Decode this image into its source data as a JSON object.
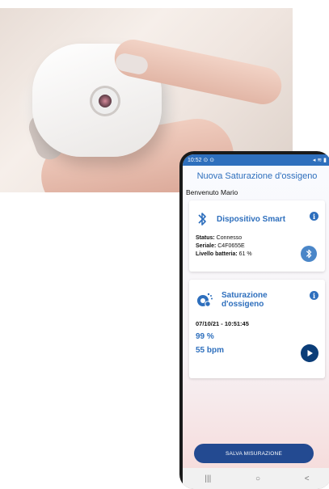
{
  "status_bar": {
    "time": "10:52",
    "left_icons": "⊙ ⊙",
    "right_icons": "◂ ≋ ▮"
  },
  "app": {
    "title": "Nuova Saturazione d'ossigeno",
    "welcome": "Benvenuto Mario"
  },
  "device_card": {
    "title": "Dispositivo Smart",
    "status_label": "Status:",
    "status_value": " Connesso",
    "serial_label": "Seriale:",
    "serial_value": " C4F0655E",
    "battery_label": "Livello batteria:",
    "battery_value": " 61 %"
  },
  "oxygen_card": {
    "title_line1": "Saturazione",
    "title_line2": "d'ossigeno",
    "datetime": "07/10/21 - 10:51:45",
    "spo2": "99 %",
    "bpm": "55 bpm"
  },
  "actions": {
    "save": "SALVA MISURAZIONE"
  },
  "nav": {
    "recent": "|||",
    "home": "○",
    "back": "<"
  },
  "colors": {
    "primary": "#2e6fbd",
    "dark_primary": "#0b3d78",
    "button": "#234a91"
  }
}
